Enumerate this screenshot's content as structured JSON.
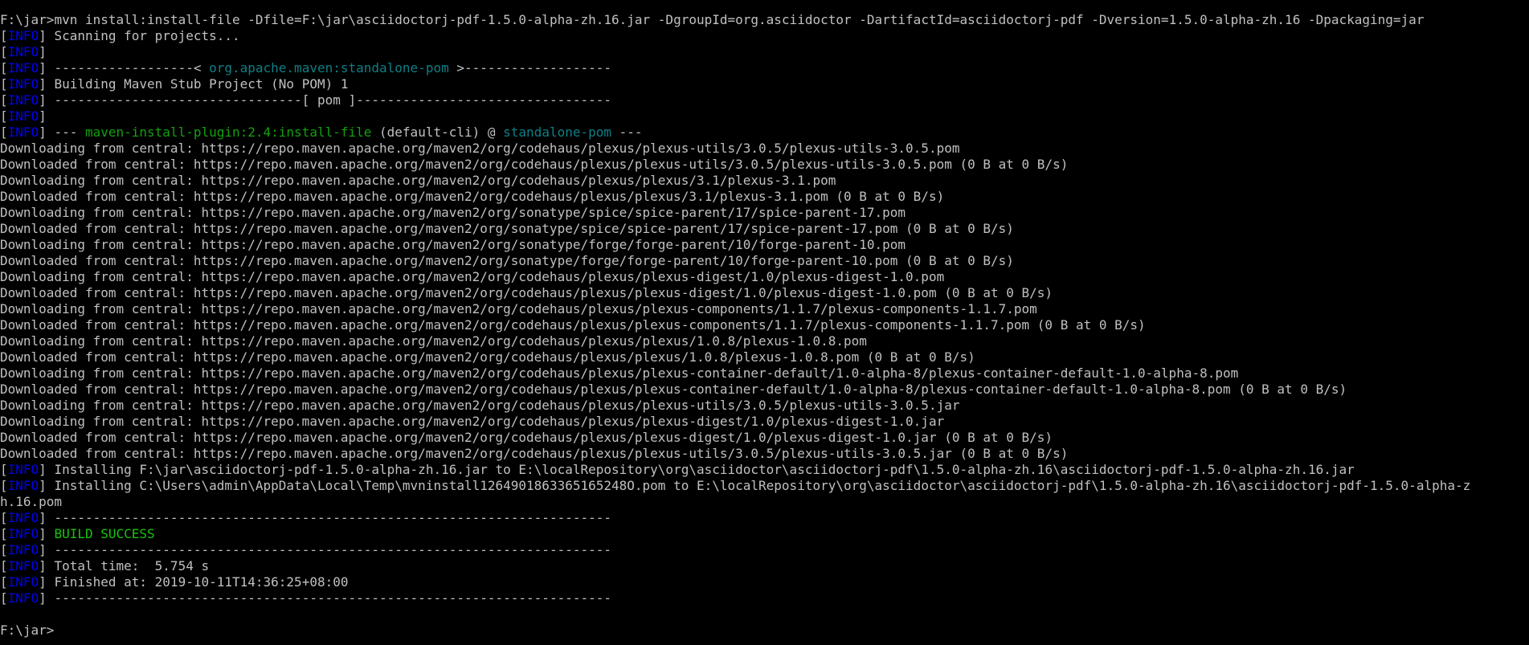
{
  "terminal": {
    "info_label": "INFO",
    "prompt": "F:\\jar>",
    "command": "mvn install:install-file -Dfile=F:\\jar\\asciidoctorj-pdf-1.5.0-alpha-zh.16.jar -DgroupId=org.asciidoctor -DartifactId=asciidoctorj-pdf -Dversion=1.5.0-alpha-zh.16 -Dpackaging=jar",
    "scanning": "Scanning for projects...",
    "sep_left": "------------------< ",
    "project_id": "org.apache.maven:standalone-pom",
    "sep_right": " >-------------------",
    "building": "Building Maven Stub Project (No POM) 1",
    "pom_sep": "--------------------------------[ pom ]---------------------------------",
    "plugin_prefix": "--- ",
    "plugin_name": "maven-install-plugin:2.4:install-file",
    "plugin_exec": " (default-cli) @ ",
    "plugin_target": "standalone-pom",
    "plugin_suffix": " ---",
    "downloads": [
      "Downloading from central: https://repo.maven.apache.org/maven2/org/codehaus/plexus/plexus-utils/3.0.5/plexus-utils-3.0.5.pom",
      "Downloaded from central: https://repo.maven.apache.org/maven2/org/codehaus/plexus/plexus-utils/3.0.5/plexus-utils-3.0.5.pom (0 B at 0 B/s)",
      "Downloading from central: https://repo.maven.apache.org/maven2/org/codehaus/plexus/plexus/3.1/plexus-3.1.pom",
      "Downloaded from central: https://repo.maven.apache.org/maven2/org/codehaus/plexus/plexus/3.1/plexus-3.1.pom (0 B at 0 B/s)",
      "Downloading from central: https://repo.maven.apache.org/maven2/org/sonatype/spice/spice-parent/17/spice-parent-17.pom",
      "Downloaded from central: https://repo.maven.apache.org/maven2/org/sonatype/spice/spice-parent/17/spice-parent-17.pom (0 B at 0 B/s)",
      "Downloading from central: https://repo.maven.apache.org/maven2/org/sonatype/forge/forge-parent/10/forge-parent-10.pom",
      "Downloaded from central: https://repo.maven.apache.org/maven2/org/sonatype/forge/forge-parent/10/forge-parent-10.pom (0 B at 0 B/s)",
      "Downloading from central: https://repo.maven.apache.org/maven2/org/codehaus/plexus/plexus-digest/1.0/plexus-digest-1.0.pom",
      "Downloaded from central: https://repo.maven.apache.org/maven2/org/codehaus/plexus/plexus-digest/1.0/plexus-digest-1.0.pom (0 B at 0 B/s)",
      "Downloading from central: https://repo.maven.apache.org/maven2/org/codehaus/plexus/plexus-components/1.1.7/plexus-components-1.1.7.pom",
      "Downloaded from central: https://repo.maven.apache.org/maven2/org/codehaus/plexus/plexus-components/1.1.7/plexus-components-1.1.7.pom (0 B at 0 B/s)",
      "Downloading from central: https://repo.maven.apache.org/maven2/org/codehaus/plexus/plexus/1.0.8/plexus-1.0.8.pom",
      "Downloaded from central: https://repo.maven.apache.org/maven2/org/codehaus/plexus/plexus/1.0.8/plexus-1.0.8.pom (0 B at 0 B/s)",
      "Downloading from central: https://repo.maven.apache.org/maven2/org/codehaus/plexus/plexus-container-default/1.0-alpha-8/plexus-container-default-1.0-alpha-8.pom",
      "Downloaded from central: https://repo.maven.apache.org/maven2/org/codehaus/plexus/plexus-container-default/1.0-alpha-8/plexus-container-default-1.0-alpha-8.pom (0 B at 0 B/s)",
      "Downloading from central: https://repo.maven.apache.org/maven2/org/codehaus/plexus/plexus-utils/3.0.5/plexus-utils-3.0.5.jar",
      "Downloading from central: https://repo.maven.apache.org/maven2/org/codehaus/plexus/plexus-digest/1.0/plexus-digest-1.0.jar",
      "Downloaded from central: https://repo.maven.apache.org/maven2/org/codehaus/plexus/plexus-digest/1.0/plexus-digest-1.0.jar (0 B at 0 B/s)",
      "Downloaded from central: https://repo.maven.apache.org/maven2/org/codehaus/plexus/plexus-utils/3.0.5/plexus-utils-3.0.5.jar (0 B at 0 B/s)"
    ],
    "install_1": "Installing F:\\jar\\asciidoctorj-pdf-1.5.0-alpha-zh.16.jar to E:\\localRepository\\org\\asciidoctor\\asciidoctorj-pdf\\1.5.0-alpha-zh.16\\asciidoctorj-pdf-1.5.0-alpha-zh.16.jar",
    "install_2": "Installing C:\\Users\\admin\\AppData\\Local\\Temp\\mvninstall1264901863365165248O.pom to E:\\localRepository\\org\\asciidoctor\\asciidoctorj-pdf\\1.5.0-alpha-zh.16\\asciidoctorj-pdf-1.5.0-alpha-z",
    "install_2_wrap": "h.16.pom",
    "rule": "------------------------------------------------------------------------",
    "build_success": "BUILD SUCCESS",
    "total_time": "Total time:  5.754 s",
    "finished_at": "Finished at: 2019-10-11T14:36:25+08:00",
    "final_prompt": "F:\\jar>"
  },
  "colors": {
    "background": "#000000",
    "text": "#c0c0c0",
    "info": "#0000ee",
    "plugin": "#13a10e",
    "project": "#0e7f86",
    "success": "#16c60c"
  }
}
